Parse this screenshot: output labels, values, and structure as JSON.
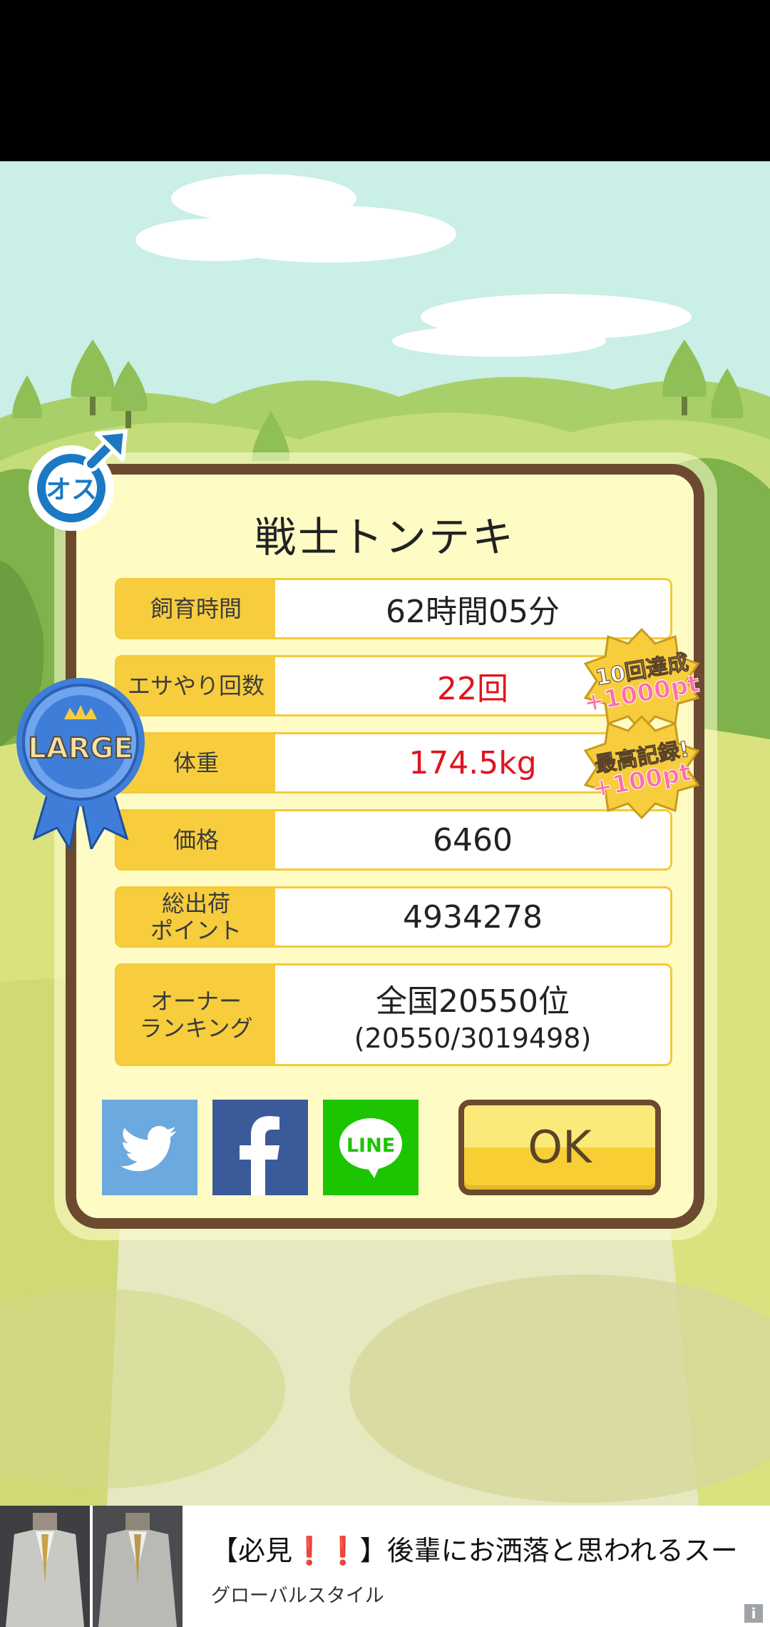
{
  "dialog": {
    "title": "戦士トンテキ",
    "rows": [
      {
        "label": "飼育時間",
        "value": "62時間05分",
        "highlight": false
      },
      {
        "label": "エサやり回数",
        "value": "22回",
        "highlight": true
      },
      {
        "label": "体重",
        "value": "174.5kg",
        "highlight": true
      },
      {
        "label": "価格",
        "value": "6460",
        "highlight": false
      },
      {
        "label_line1": "総出荷",
        "label_line2": "ポイント",
        "value": "4934278",
        "highlight": false
      },
      {
        "label_line1": "オーナー",
        "label_line2": "ランキング",
        "value": "全国20550位",
        "sub_value": "(20550/3019498)",
        "highlight": false
      }
    ],
    "ok_label": "OK"
  },
  "badges": {
    "gender": "オス",
    "size": "LARGE",
    "bonus1_line1": "10回達成",
    "bonus1_line2": "+1000pt",
    "bonus2_line1": "最高記録!",
    "bonus2_line2": "+100pt"
  },
  "social": {
    "line_label": "LINE",
    "twitter_icon": "twitter-bird-icon",
    "facebook_icon": "facebook-f-icon",
    "twitter_color": "#6ca9de",
    "facebook_color": "#3b5a9a",
    "line_color": "#1dc400"
  },
  "ad": {
    "title_prefix": "【必見",
    "title_marks": "❗❗",
    "title_suffix": "】後輩にお洒落と思われるスー",
    "source": "グローバルスタイル",
    "info_icon": "i"
  },
  "colors": {
    "label_bg": "#f7cd3d",
    "dialog_bg": "#fffbc4",
    "dialog_border": "#6b4a2f",
    "highlight_text": "#e0141e"
  }
}
